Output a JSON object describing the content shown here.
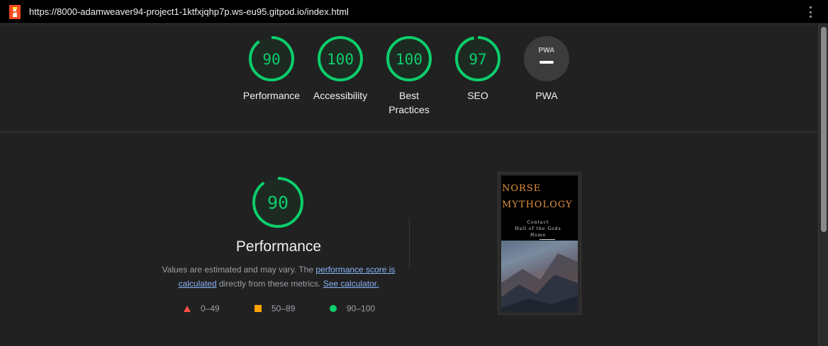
{
  "browser": {
    "url": "https://8000-adamweaver94-project1-1ktfxjqhp7p.ws-eu95.gitpod.io/index.html"
  },
  "colors": {
    "pass": "#0cce6b",
    "average": "#ffa400",
    "fail": "#ff4e42"
  },
  "summary_gauges": [
    {
      "label": "Performance",
      "score": "90",
      "fraction": 0.9
    },
    {
      "label": "Accessibility",
      "score": "100",
      "fraction": 1.0
    },
    {
      "label": "Best Practices",
      "score": "100",
      "fraction": 1.0
    },
    {
      "label": "SEO",
      "score": "97",
      "fraction": 0.97
    },
    {
      "label": "PWA",
      "badge": "PWA"
    }
  ],
  "performance": {
    "score": "90",
    "fraction": 0.9,
    "title": "Performance",
    "desc_prefix": "Values are estimated and may vary. The ",
    "link_score": "performance score is calculated",
    "desc_middle": " directly from these metrics. ",
    "link_calc": "See calculator.",
    "legend": {
      "fail": "0–49",
      "average": "50–89",
      "pass": "90–100"
    }
  },
  "screenshot": {
    "title_line1": "NORSE",
    "title_line2": "MYTHOLOGY",
    "nav": [
      "Contact",
      "Hall of the Gods",
      "Home"
    ]
  }
}
